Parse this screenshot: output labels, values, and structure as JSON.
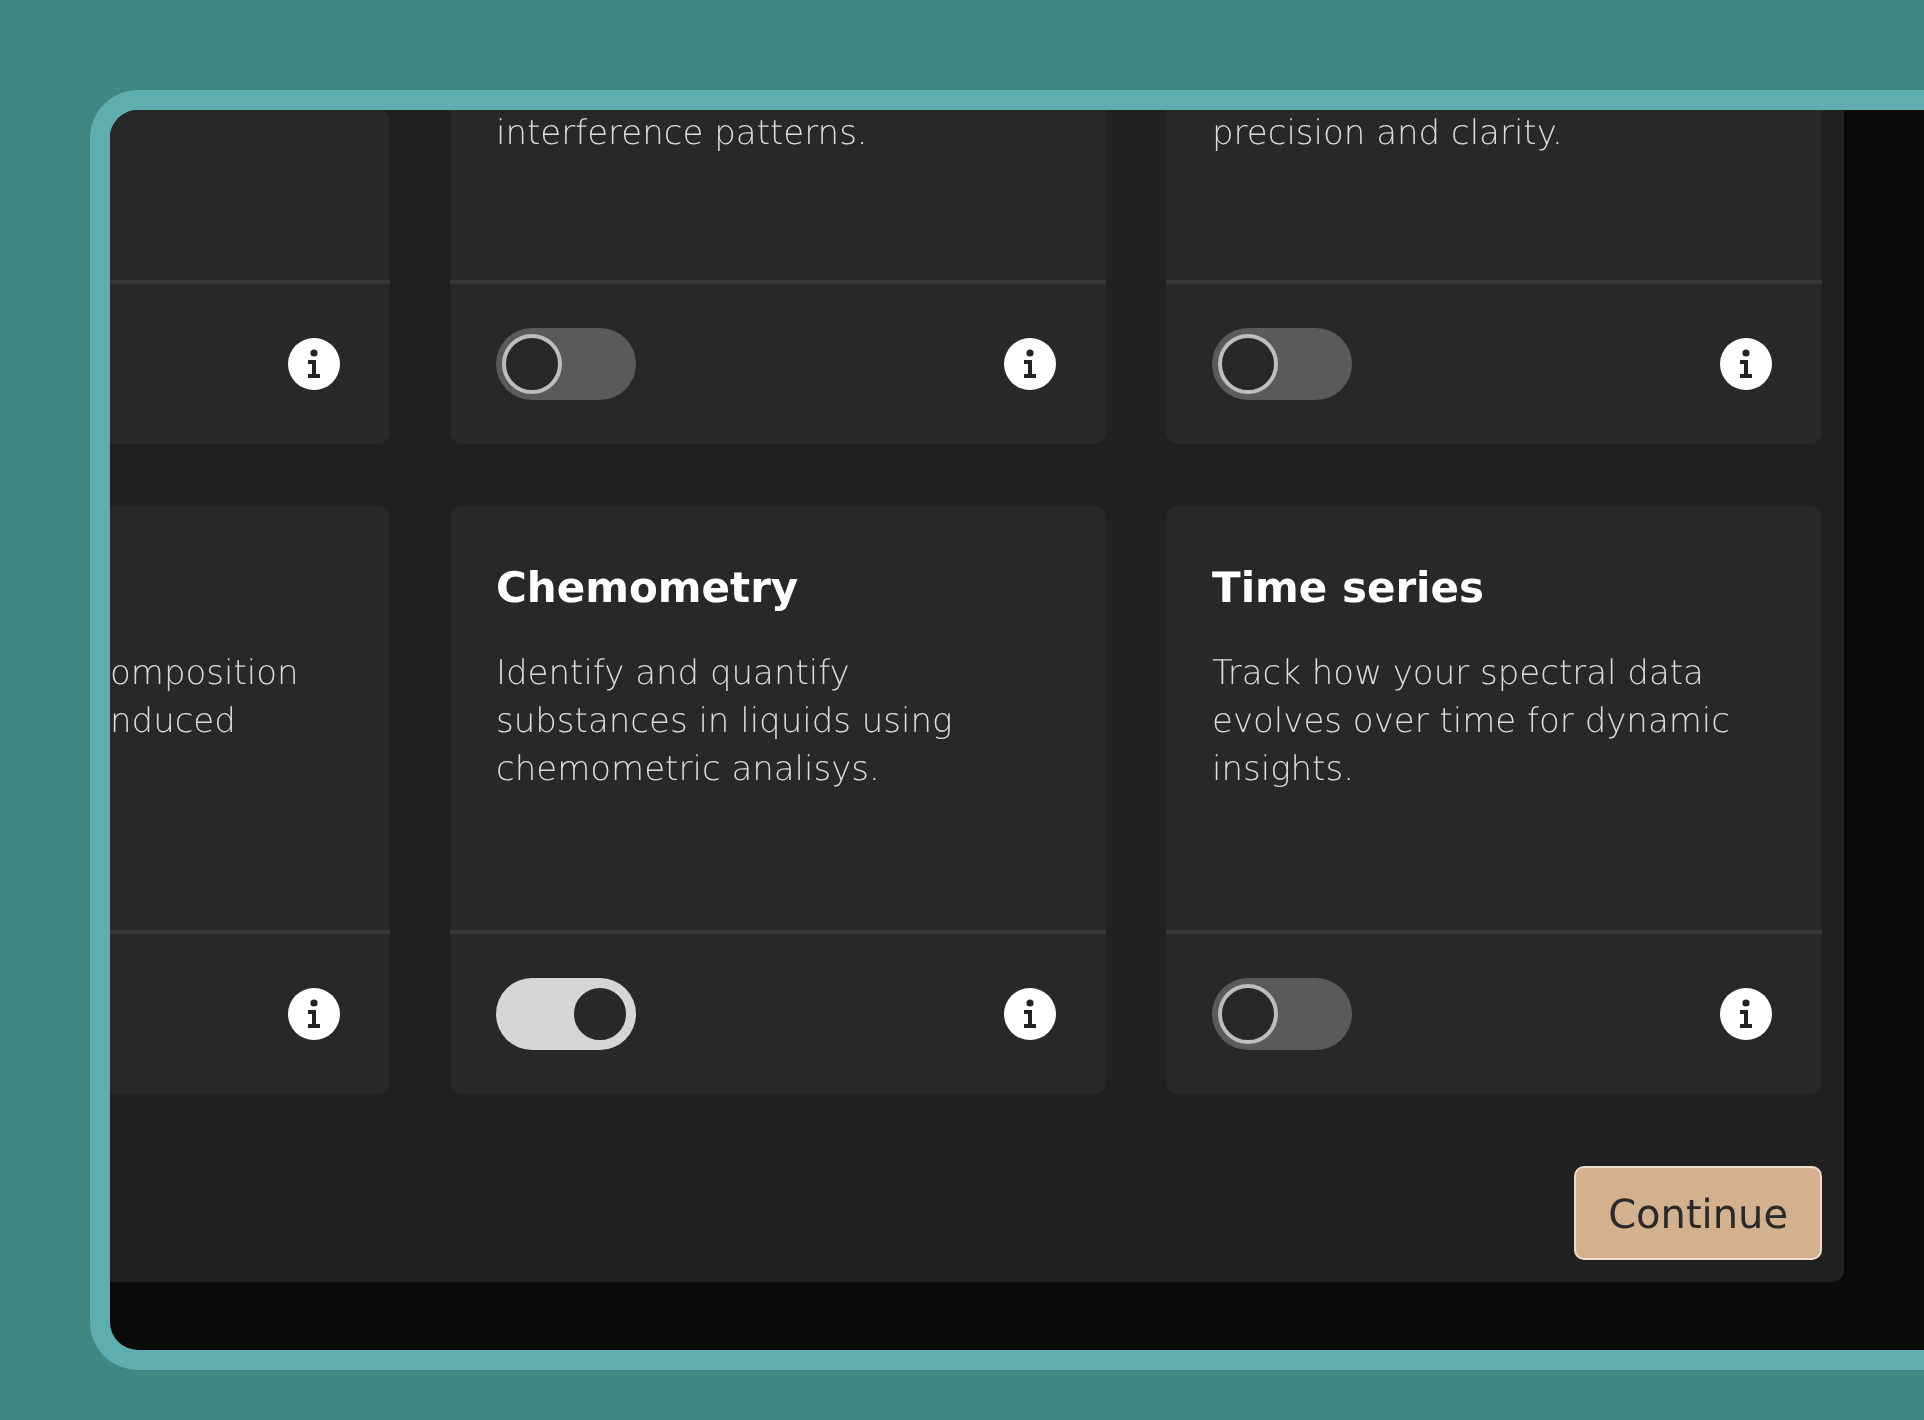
{
  "rows": [
    {
      "cards": [
        {
          "kind": "partial"
        },
        {
          "kind": "full",
          "description_lines": [
            "interference patterns."
          ],
          "toggle": {
            "on": false
          }
        },
        {
          "kind": "full",
          "description_lines": [
            "precision and clarity."
          ],
          "toggle": {
            "on": false
          }
        }
      ]
    },
    {
      "cards": [
        {
          "kind": "partial",
          "description_lines": [
            "omposition",
            "nduced"
          ]
        },
        {
          "kind": "full",
          "title": "Chemometry",
          "description_lines": [
            "Identify and quantify",
            "substances in liquids using",
            "chemometric analisys."
          ],
          "toggle": {
            "on": true
          }
        },
        {
          "kind": "full",
          "title": "Time series",
          "description_lines": [
            "Track how your spectral data",
            "evolves over time for dynamic",
            "insights."
          ],
          "toggle": {
            "on": false
          }
        }
      ]
    }
  ],
  "continue_button": "Continue"
}
